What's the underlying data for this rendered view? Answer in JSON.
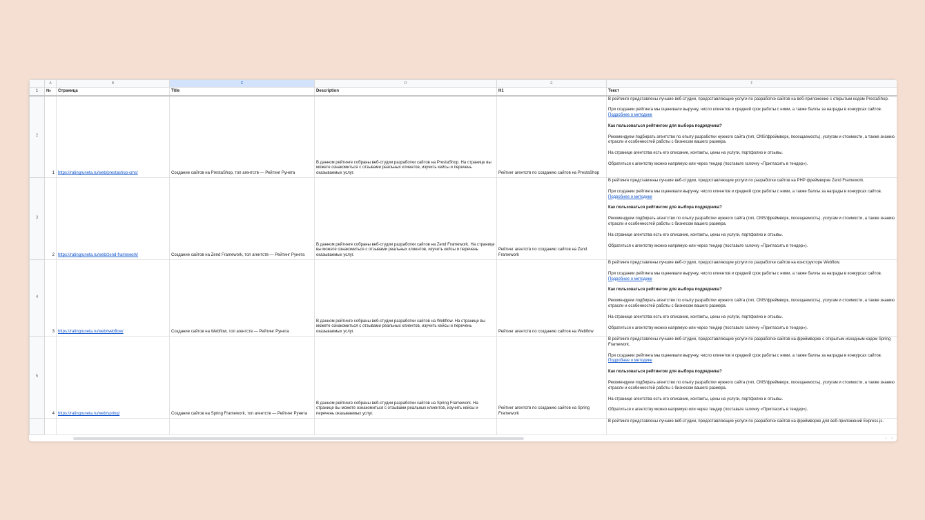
{
  "columns": {
    "letters": [
      "A",
      "B",
      "C",
      "D",
      "E",
      "F"
    ],
    "headers": [
      "№",
      "Страница",
      "Title",
      "Description",
      "H1",
      "Текст"
    ]
  },
  "row_numbers": [
    "1",
    "2",
    "3",
    "4",
    "5"
  ],
  "rows": [
    {
      "num": "1",
      "url": "https://ratingruneta.ru/web/prestashop-cms/",
      "title": "Создание сайтов на PrestaShop, топ агентств — Рейтинг Рунета",
      "description": "В данном рейтинге собраны веб-студии разработки сайтов на PrestaShop. На странице вы можете ознакомиться с отзывами реальных клиентов, изучить кейсы и перечень оказываемых услуг.",
      "h1": "Рейтинг агентств по созданию сайтов на PrestaShop",
      "text_intro": "В рейтинге представлены лучшие веб-студии, предоставляющие услуги по разработке сайтов на веб-приложение с открытым кодом PrestaShop.",
      "text_method": "При создании рейтинга мы оценивали выручку, число клиентов и средний срок работы с ними, а также баллы за награды в конкурсах сайтов.",
      "text_method_link": "Подробнее о методике",
      "text_howto": "Как пользоваться рейтингом для выбора подрядчика?",
      "text_recommend": "Рекомендуем подбирать агентство по опыту разработки нужного сайта (тип, CMS/фреймворк, посещаемость), услугам и стоимости, а также знанию отрасли и особенностей работы с бизнесом вашего размера.",
      "text_agency": "На странице агентства есть его описание, контакты, цены на услуги, портфолио и отзывы.",
      "text_contact": "Обратиться к агентству можно напрямую или через тендер (поставьте галочку «Пригласить в тендер»)."
    },
    {
      "num": "2",
      "url": "https://ratingruneta.ru/web/zend-framework/",
      "title": "Создание сайтов на Zend Framework, топ агентств — Рейтинг Рунета",
      "description": "В данном рейтинге собраны веб-студии разработки сайтов на Zend Framework. На странице вы можете ознакомиться с отзывами реальных клиентов, изучить кейсы и перечень оказываемых услуг.",
      "h1": "Рейтинг агентств по созданию сайтов на Zend Framework",
      "text_intro": "В рейтинге представлены лучшие веб-студии, предоставляющие услуги по разработке сайтов на PHP фреймворке Zend Framework.",
      "text_method": "При создании рейтинга мы оценивали выручку, число клиентов и средний срок работы с ними, а также баллы за награды в конкурсах сайтов.",
      "text_method_link": "Подробнее о методике",
      "text_howto": "Как пользоваться рейтингом для выбора подрядчика?",
      "text_recommend": "Рекомендуем подбирать агентство по опыту разработки нужного сайта (тип, CMS/фреймворк, посещаемость), услугам и стоимости, а также знанию отрасли и особенностей работы с бизнесом вашего размера.",
      "text_agency": "На странице агентства есть его описание, контакты, цены на услуги, портфолио и отзывы.",
      "text_contact": "Обратиться к агентству можно напрямую или через тендер (поставьте галочку «Пригласить в тендер»)."
    },
    {
      "num": "3",
      "url": "https://ratingruneta.ru/web/webflow/",
      "title": "Создание сайтов на Webflow, топ агентств — Рейтинг Рунета",
      "description": "В данном рейтинге собраны веб-студии разработки сайтов на Webflow. На странице вы можете ознакомиться с отзывами реальных клиентов, изучить кейсы и перечень оказываемых услуг.",
      "h1": "Рейтинг агентств по созданию сайтов на Webflow",
      "text_intro": "В рейтинге представлены лучшие веб-студии, предоставляющие услуги по разработке сайтов на конструкторе Webflow.",
      "text_method": "При создании рейтинга мы оценивали выручку, число клиентов и средний срок работы с ними, а также баллы за награды в конкурсах сайтов.",
      "text_method_link": "Подробнее о методике",
      "text_howto": "Как пользоваться рейтингом для выбора подрядчика?",
      "text_recommend": "Рекомендуем подбирать агентство по опыту разработки нужного сайта (тип, CMS/фреймворк, посещаемость), услугам и стоимости, а также знанию отрасли и особенностей работы с бизнесом вашего размера.",
      "text_agency": "На странице агентства есть его описание, контакты, цены на услуги, портфолио и отзывы.",
      "text_contact": "Обратиться к агентству можно напрямую или через тендер (поставьте галочку «Пригласить в тендер»)."
    },
    {
      "num": "4",
      "url": "https://ratingruneta.ru/web/spring/",
      "title": "Создание сайтов на Spring Framework, топ агентств — Рейтинг Рунета",
      "description": "В данном рейтинге собраны веб-студии разработки сайтов на Spring Framework. На странице вы можете ознакомиться с отзывами реальных клиентов, изучить кейсы и перечень оказываемых услуг.",
      "h1": "Рейтинг агентств по созданию сайтов на Spring Framework",
      "text_intro": "В рейтинге представлены лучшие веб-студии, предоставляющие услуги по разработке сайтов на фреймворке с открытым исходным кодом Spring Framework.",
      "text_method": "При создании рейтинга мы оценивали выручку, число клиентов и средний срок работы с ними, а также баллы за награды в конкурсах сайтов.",
      "text_method_link": "Подробнее о методике",
      "text_howto": "Как пользоваться рейтингом для выбора подрядчика?",
      "text_recommend": "Рекомендуем подбирать агентство по опыту разработки нужного сайта (тип, CMS/фреймворк, посещаемость), услугам и стоимости, а также знанию отрасли и особенностей работы с бизнесом вашего размера.",
      "text_agency": "На странице агентства есть его описание, контакты, цены на услуги, портфолио и отзывы.",
      "text_contact": "Обратиться к агентству можно напрямую или через тендер (поставьте галочку «Пригласить в тендер»)."
    }
  ],
  "partial_row": {
    "text_intro": "В рейтинге представлены лучшие веб-студии, предоставляющие услуги по разработке сайтов на фреймворке для веб-приложений Express.js."
  },
  "scroll": {
    "left_arrow": "‹",
    "right_arrow": "›"
  }
}
